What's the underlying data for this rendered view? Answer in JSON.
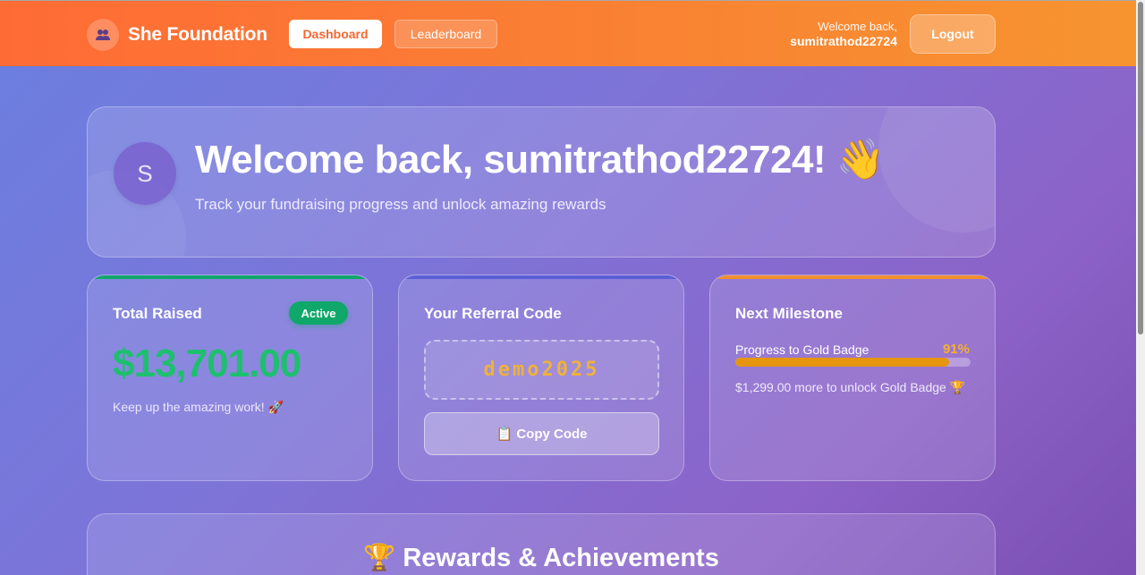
{
  "header": {
    "brand_icon": "people-icon",
    "brand_name": "She Foundation",
    "nav": {
      "dashboard": "Dashboard",
      "leaderboard": "Leaderboard"
    },
    "welcome_small": "Welcome back,",
    "username": "sumitrathod22724",
    "logout": "Logout"
  },
  "hero": {
    "avatar_initial": "S",
    "title": "Welcome back, sumitrathod22724! 👋",
    "subtitle": "Track your fundraising progress and unlock amazing rewards"
  },
  "total_raised": {
    "title": "Total Raised",
    "badge": "Active",
    "amount": "$13,701.00",
    "note": "Keep up the amazing work! 🚀",
    "accent": "#10a86a"
  },
  "referral": {
    "title": "Your Referral Code",
    "code": "demo2025",
    "copy_label": "📋 Copy Code",
    "accent": "#5b5fd6"
  },
  "milestone": {
    "title": "Next Milestone",
    "progress_label": "Progress to Gold Badge",
    "progress_pct": "91%",
    "progress_value": 0.91,
    "note": "$1,299.00 more to unlock Gold Badge 🏆",
    "accent": "#f0902e"
  },
  "rewards": {
    "title": "🏆 Rewards & Achievements"
  }
}
